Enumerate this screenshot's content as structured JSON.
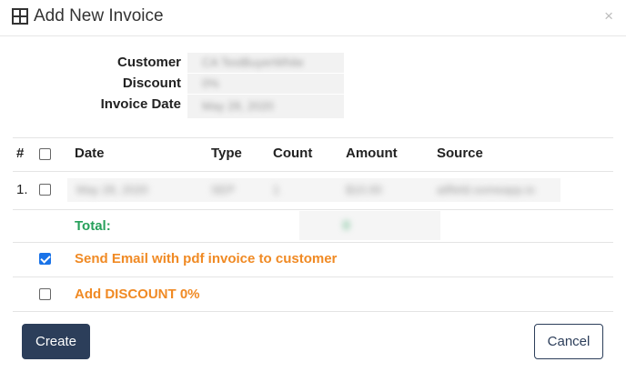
{
  "dialog": {
    "title": "Add New Invoice",
    "title_icon": "table-icon",
    "close_label": "×"
  },
  "info": {
    "customer_label": "Customer",
    "customer_value": "CA TestBuyerWhite",
    "discount_label": "Discount",
    "discount_value": "0%",
    "invoice_date_label": "Invoice Date",
    "invoice_date_value": "May 28, 2020"
  },
  "table": {
    "headers": {
      "num": "#",
      "date": "Date",
      "type": "Type",
      "count": "Count",
      "amount": "Amount",
      "source": "Source"
    },
    "rows": [
      {
        "num": "1.",
        "date": "May 28, 2020",
        "type": "SEP",
        "count": "1",
        "amount": "$10.00",
        "source": "ailfield.someapp.io"
      }
    ],
    "total_label": "Total:",
    "total_value": "0"
  },
  "options": {
    "send_email_label": "Send Email with pdf invoice to customer",
    "send_email_checked": true,
    "add_discount_label": "Add DISCOUNT 0%",
    "add_discount_checked": false
  },
  "buttons": {
    "create": "Create",
    "cancel": "Cancel"
  },
  "colors": {
    "primary": "#2c3e5a",
    "total_green": "#27a05b",
    "option_orange": "#f08a24",
    "checkbox_blue": "#1a73e8"
  }
}
